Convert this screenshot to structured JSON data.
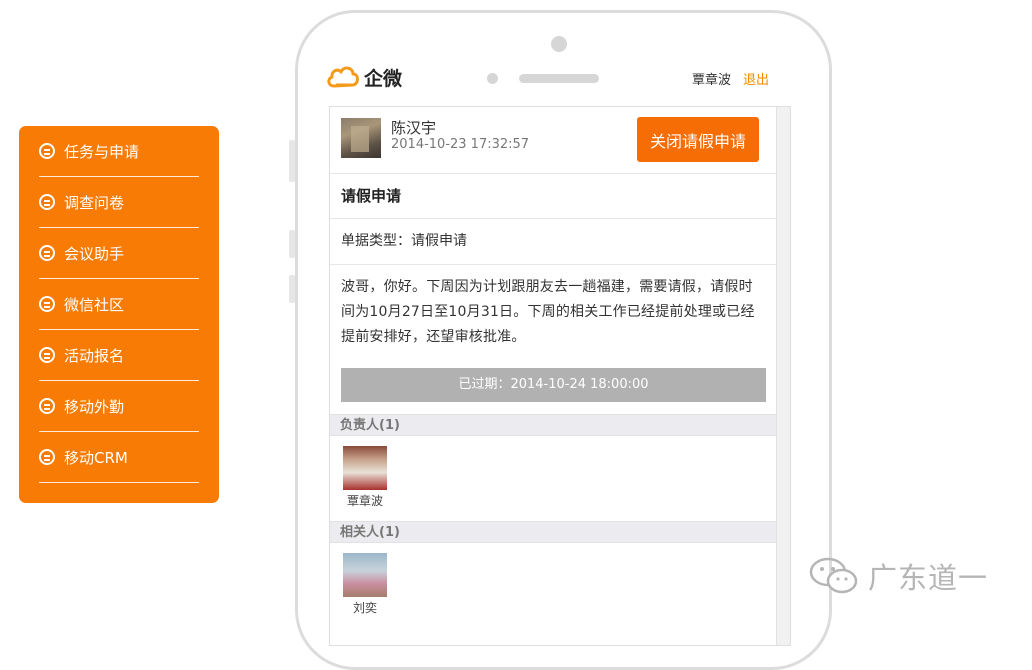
{
  "sidebar": {
    "items": [
      {
        "label": "任务与申请"
      },
      {
        "label": "调查问卷"
      },
      {
        "label": "会议助手"
      },
      {
        "label": "微信社区"
      },
      {
        "label": "活动报名"
      },
      {
        "label": "移动外勤"
      },
      {
        "label": "移动CRM"
      }
    ]
  },
  "header": {
    "logo_text": "企微",
    "user_name": "覃章波",
    "logout_label": "退出"
  },
  "message": {
    "sender_name": "陈汉宇",
    "sender_time": "2014-10-23 17:32:57",
    "close_button_label": "关闭请假申请",
    "title": "请假申请",
    "doc_type": "单据类型：请假申请",
    "body": "波哥，你好。下周因为计划跟朋友去一趟福建，需要请假，请假时间为10月27日至10月31日。下周的相关工作已经提前处理或已经提前安排好，还望审核批准。",
    "expired_label": "已过期：2014-10-24 18:00:00"
  },
  "responsible": {
    "header": "负责人(1)",
    "people": [
      {
        "name": "覃章波"
      }
    ]
  },
  "related": {
    "header": "相关人(1)",
    "people": [
      {
        "name": "刘奕"
      }
    ]
  },
  "watermark": {
    "text": "广东道一",
    "icon": "wechat-icon"
  },
  "colors": {
    "accent": "#f77b04",
    "button": "#f66c05",
    "expired": "#b1b1b1"
  }
}
